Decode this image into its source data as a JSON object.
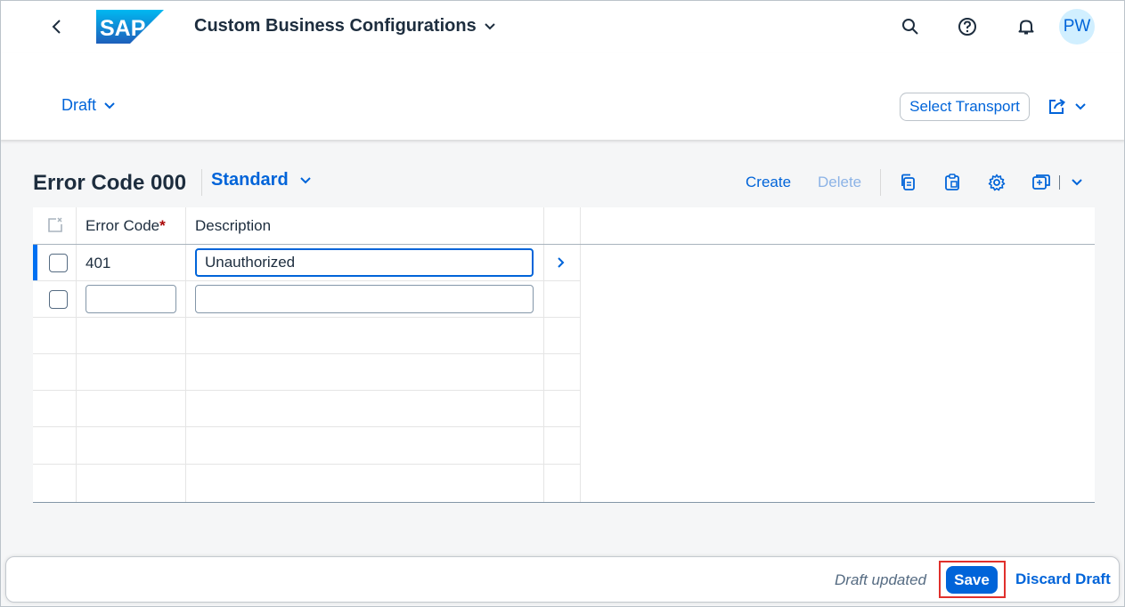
{
  "shell": {
    "logo_text": "SAP",
    "app_title": "Custom Business Configurations",
    "avatar_initials": "PW",
    "icons": [
      "back-arrow-icon",
      "search-icon",
      "help-icon",
      "notification-bell-icon"
    ]
  },
  "header": {
    "draft_label": "Draft",
    "select_transport_label": "Select Transport"
  },
  "table_card": {
    "title": "Error Code 000",
    "variant": "Standard",
    "create_label": "Create",
    "delete_label": "Delete",
    "columns": [
      "Error Code",
      "Description"
    ],
    "required_marker": "*",
    "rows": [
      {
        "error_code": "401",
        "description": "Unauthorized"
      },
      {
        "error_code": "",
        "description": ""
      }
    ]
  },
  "footer": {
    "status": "Draft updated",
    "save_label": "Save",
    "discard_label": "Discard Draft"
  },
  "colors": {
    "accent": "#0064d9",
    "highlight_box": "#e0302c",
    "avatar_bg": "#d1efff"
  }
}
